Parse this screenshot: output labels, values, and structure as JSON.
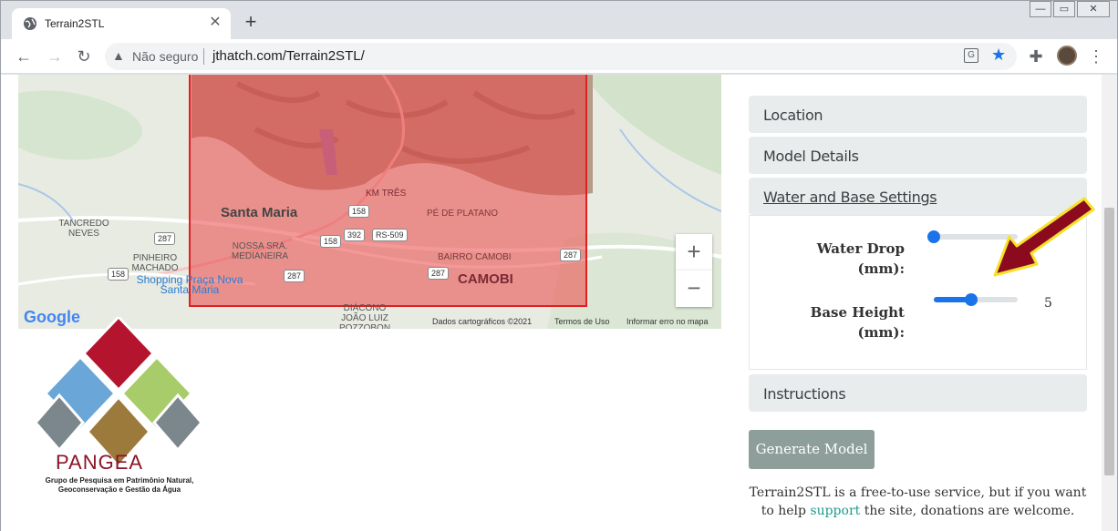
{
  "browser": {
    "tab_title": "Terrain2STL",
    "security_label": "Não seguro",
    "url": "jthatch.com/Terrain2STL/",
    "translate_label": "G"
  },
  "map": {
    "labels": {
      "santa_maria": "Santa Maria",
      "camobi": "CAMOBI",
      "km_tres": "KM TRÊS",
      "pe_de_platano": "PÉ DE PLATANO",
      "bairro_camobi": "BAIRRO CAMOBI",
      "tancredo": "TANCREDO NEVES",
      "pinheiro": "PINHEIRO MACHADO",
      "nossa_sra": "NOSSA SRA. MEDIANEIRA",
      "shopping": "Shopping Praça Nova Santa Maria",
      "diacono": "DIÁCONO JOÃO LUIZ POZZOBON"
    },
    "shields": [
      "287",
      "158",
      "158",
      "392",
      "RS-509",
      "158",
      "287",
      "287",
      "287"
    ],
    "zoom_in": "+",
    "zoom_out": "−",
    "google": "Google",
    "attribution": "Dados cartográficos ©2021",
    "terms": "Termos de Uso",
    "report": "Informar erro no mapa"
  },
  "logo": {
    "name": "PANGEA",
    "subtitle": "Grupo de Pesquisa em Patrimônio Natural, Geoconservação e Gestão da Água",
    "colors": [
      "#b5142f",
      "#6aa6d8",
      "#a8cc6a",
      "#7b868d",
      "#9c7a3c",
      "#7b868d"
    ]
  },
  "panel": {
    "location": "Location",
    "model_details": "Model Details",
    "water_base": "Water and Base Settings",
    "water_drop_label": "Water Drop (mm):",
    "base_height_label": "Base Height (mm):",
    "water_drop_value": 0,
    "base_height_value": "5",
    "base_height_fraction": 0.45,
    "instructions": "Instructions",
    "generate": "Generate Model",
    "footer_pre": "Terrain2STL is a free-to-use service, but if you want to help",
    "footer_link": "support",
    "footer_post": "the site, donations are welcome."
  },
  "colors": {
    "accent": "#1a73e8",
    "selection": "#e01f1f",
    "button": "#8e9e9a",
    "arrow": "#8b0a1e"
  }
}
